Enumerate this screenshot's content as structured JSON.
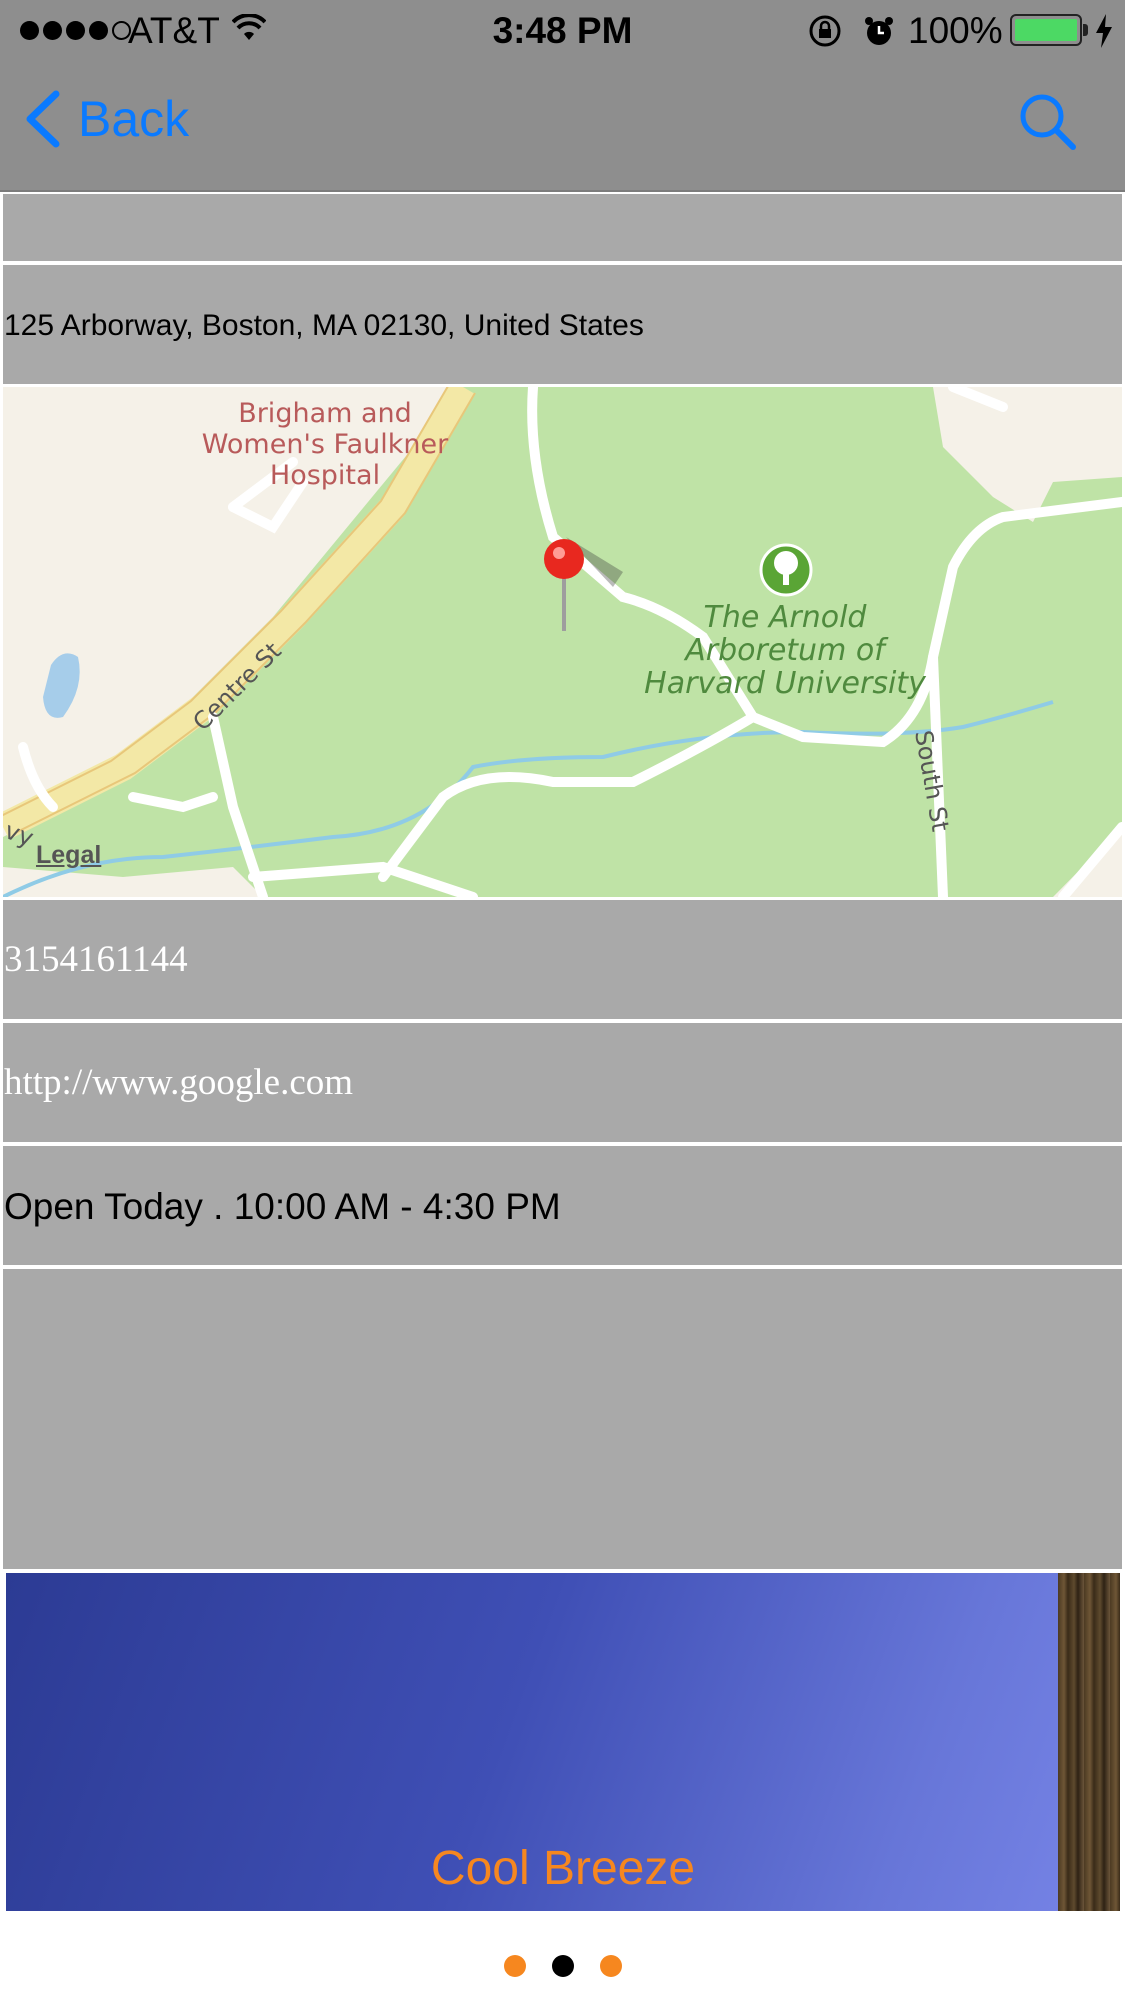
{
  "status_bar": {
    "carrier": "AT&T",
    "time": "3:48 PM",
    "battery_percent": "100%",
    "battery_color": "#4cd964"
  },
  "nav": {
    "back_label": "Back",
    "back_icon": "chevron-left-icon",
    "search_icon": "search-icon",
    "accent_color": "#0a7aff"
  },
  "details": {
    "address": "125 Arborway, Boston, MA 02130, United States",
    "phone": "3154161144",
    "website": "http://www.google.com",
    "hours": "Open Today . 10:00 AM - 4:30 PM"
  },
  "map": {
    "labels": {
      "hospital_line1": "Brigham and",
      "hospital_line2": "Women's Faulkner",
      "hospital_line3": "Hospital",
      "park_line1": "The Arnold",
      "park_line2": "Arboretum of",
      "park_line3": "Harvard University",
      "street_centre": "Centre St",
      "street_south": "South St",
      "street_partial": "vy"
    },
    "legal": "Legal",
    "pin_icon": "map-pin-icon",
    "park_icon": "tree-icon"
  },
  "banner": {
    "caption": "Cool Breeze",
    "caption_color": "#f6871f"
  },
  "pager": {
    "page_count": 3,
    "active_page": 2
  }
}
